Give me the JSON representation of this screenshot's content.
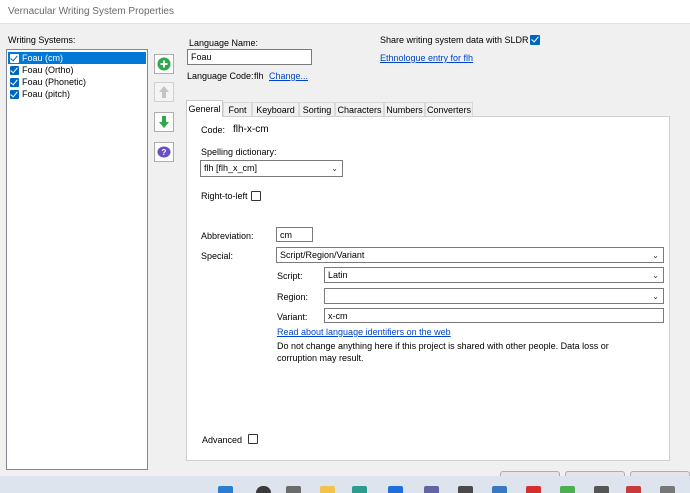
{
  "window": {
    "title": "Vernacular Writing System Properties"
  },
  "writing_systems": {
    "label": "Writing Systems:",
    "items": [
      {
        "label": "Foau (cm)",
        "checked": true,
        "selected": true
      },
      {
        "label": "Foau (Ortho)",
        "checked": true,
        "selected": false
      },
      {
        "label": "Foau (Phonetic)",
        "checked": true,
        "selected": false
      },
      {
        "label": "Foau (pitch)",
        "checked": true,
        "selected": false
      }
    ]
  },
  "side_buttons": [
    {
      "name": "add-icon",
      "enabled": true
    },
    {
      "name": "move-up-icon",
      "enabled": false
    },
    {
      "name": "move-down-icon",
      "enabled": true
    },
    {
      "name": "help-icon",
      "enabled": true
    }
  ],
  "language": {
    "name_label": "Language Name:",
    "name_value": "Foau",
    "code_label": "Language Code:",
    "code_value": "flh",
    "change_link": "Change..."
  },
  "sldr": {
    "label": "Share writing system data with SLDR",
    "checked": true
  },
  "ethnologue_link": "Ethnologue entry for flh",
  "tabs": [
    "General",
    "Font",
    "Keyboard",
    "Sorting",
    "Characters",
    "Numbers",
    "Converters"
  ],
  "active_tab": "General",
  "general": {
    "code_label": "Code:",
    "code_value": "flh-x-cm",
    "spelling_label": "Spelling dictionary:",
    "spelling_value": "flh [flh_x_cm]",
    "rtl_label": "Right-to-left",
    "rtl_checked": false,
    "abbrev_label": "Abbreviation:",
    "abbrev_value": "cm",
    "special_label": "Special:",
    "special_value": "Script/Region/Variant",
    "script_label": "Script:",
    "script_value": "Latin",
    "region_label": "Region:",
    "region_value": "",
    "variant_label": "Variant:",
    "variant_value": "x-cm",
    "read_link": "Read about language identifiers on the web",
    "warning": "Do not change anything here if this project is shared with other people.  Data loss or corruption may result.",
    "advanced_label": "Advanced",
    "advanced_checked": false
  },
  "colors": {
    "selection": "#0078d7",
    "link": "#0044cc",
    "add_green": "#2da84a",
    "help_purple": "#6a4fc4"
  }
}
